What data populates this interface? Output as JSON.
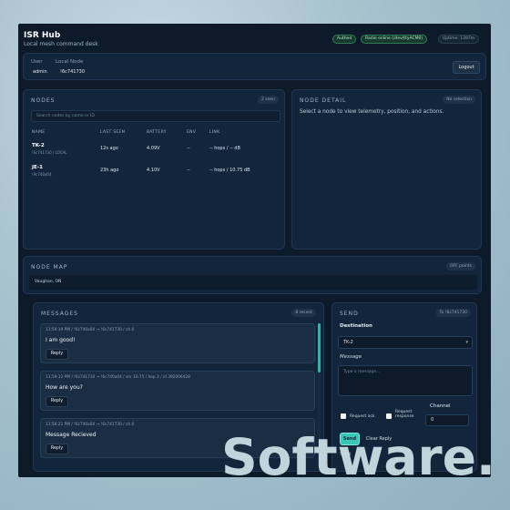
{
  "header": {
    "title": "ISR Hub",
    "subtitle": "Local mesh command desk",
    "pills": {
      "auth": "Authed",
      "radio": "Radio online (/dev/ttyACM0)",
      "uptime": "Uptime: 1397m"
    }
  },
  "user_panel": {
    "user_label": "User",
    "user_value": "admin",
    "node_label": "Local Node",
    "node_value": "!6c741730",
    "logout_label": "Logout"
  },
  "nodes": {
    "title": "NODES",
    "seen_badge": "2 seen",
    "search_placeholder": "Search nodes by name or ID",
    "columns": [
      "NAME",
      "LAST SEEN",
      "BATTERY",
      "ENV",
      "LINK"
    ],
    "rows": [
      {
        "name": "TK-2",
        "sub": "!6c741730 / LOCAL",
        "last_seen": "12s ago",
        "battery": "4.09V",
        "env": "--",
        "link": "-- hops / -- dB"
      },
      {
        "name": "JE-1",
        "sub": "!9c740a04",
        "last_seen": "23h ago",
        "battery": "4.10V",
        "env": "--",
        "link": "-- hops / 10.75 dB"
      }
    ]
  },
  "node_detail": {
    "title": "NODE DETAIL",
    "badge": "No selection",
    "text": "Select a node to view telemetry, position, and actions."
  },
  "node_map": {
    "title": "NODE MAP",
    "badge": "OFF points",
    "location": "Vaughan, ON"
  },
  "messages": {
    "title": "MESSAGES",
    "badge": "8 recent",
    "reply_label": "Reply",
    "items": [
      {
        "meta": "11:59:19 PM / !6c740a04 → !6c741730 / ch 0",
        "body": "I am good!"
      },
      {
        "meta": "11:59:12 PM / !6c741730 → !6c740a04 / snr 10.75 / hop 3 / id 392006428",
        "body": "How are you?"
      },
      {
        "meta": "11:58:21 PM / !6c740a04 → !6c741730 / ch 0",
        "body": "Message Recieved"
      }
    ]
  },
  "send": {
    "title": "SEND",
    "badge": "To !6c741730",
    "destination_label": "Destination",
    "destination_value": "TK-2",
    "message_label": "Message",
    "message_placeholder": "Type a message...",
    "request_ack_label": "Request ack",
    "request_response_label": "Request response",
    "channel_label": "Channel",
    "channel_value": "0",
    "send_label": "Send",
    "clear_label": "Clear Reply",
    "status": "Sent"
  },
  "watermark": "Software.",
  "colors": {
    "accent": "#39c6b4",
    "panel": "#13253a",
    "background": "#0d1a2a"
  },
  "icons": {
    "select_chevron": "chevron-down-icon"
  }
}
